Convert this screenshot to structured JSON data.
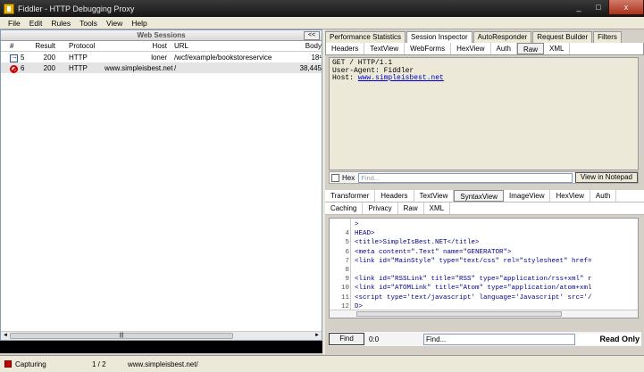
{
  "window": {
    "title": "Fiddler - HTTP Debugging Proxy",
    "min": "_",
    "max": "□",
    "close": "x"
  },
  "menu": [
    "File",
    "Edit",
    "Rules",
    "Tools",
    "View",
    "Help"
  ],
  "sessions": {
    "title": "Web Sessions",
    "collapse_label": "<<",
    "columns": {
      "num": "#",
      "result": "Result",
      "protocol": "Protocol",
      "host": "Host",
      "url": "URL",
      "body": "Body"
    },
    "rows": [
      {
        "num": "5",
        "result": "200",
        "protocol": "HTTP",
        "host": "loner",
        "url": "/wcf/example/bookstoreservice",
        "body": "18¹",
        "icon": "arrow-icon"
      },
      {
        "num": "6",
        "result": "200",
        "protocol": "HTTP",
        "host": "www.simpleisbest.net",
        "url": "/",
        "body": "38,445",
        "icon": "blocked-icon"
      }
    ]
  },
  "inspector": {
    "tabs": [
      "Performance Statistics",
      "Session Inspector",
      "AutoResponder",
      "Request Builder",
      "Filters"
    ],
    "active_tab": "Session Inspector",
    "request_tabs": [
      "Headers",
      "TextView",
      "WebForms",
      "HexView",
      "Auth",
      "Raw",
      "XML"
    ],
    "request_text_line1": "GET / HTTP/1.1",
    "request_text_line2": "User-Agent: Fiddler",
    "request_host_label": "Host: ",
    "request_host_value": "www.simpleisbest.net",
    "hex_label": "Hex",
    "find_placeholder": "Find...",
    "notepad_label": "View in Notepad",
    "response_tabs_row1": [
      "Transformer",
      "Headers",
      "TextView",
      "SyntaxView",
      "ImageView",
      "HexView",
      "Auth"
    ],
    "response_tabs_row2": [
      "Caching",
      "Privacy",
      "Raw",
      "XML"
    ],
    "code_lines": [
      {
        "n": "",
        "text": ">"
      },
      {
        "n": "4",
        "text": "HEAD>"
      },
      {
        "n": "5",
        "text": "   <title>SimpleIsBest.NET</title>"
      },
      {
        "n": "6",
        "text": "   <meta content=\".Text\" name=\"GENERATOR\">"
      },
      {
        "n": "7",
        "text": "   <link id=\"MainStyle\" type=\"text/css\" rel=\"stylesheet\" href="
      },
      {
        "n": "8",
        "text": ""
      },
      {
        "n": "9",
        "text": "   <link id=\"RSSLink\" title=\"RSS\" type=\"application/rss+xml\" r"
      },
      {
        "n": "10",
        "text": "   <link id=\"ATOMLink\" title=\"Atom\" type=\"application/atom+xml"
      },
      {
        "n": "11",
        "text": "   <script type='text/javascript' language='Javascript' src='/"
      },
      {
        "n": "12",
        "text": "D>"
      }
    ],
    "find_button": "Find",
    "find_count": "0:0",
    "find_value": "Find...",
    "read_only": "Read Only"
  },
  "status": {
    "capturing": "Capturing",
    "count": "1 / 2",
    "url": "www.simpleisbest.net/"
  }
}
